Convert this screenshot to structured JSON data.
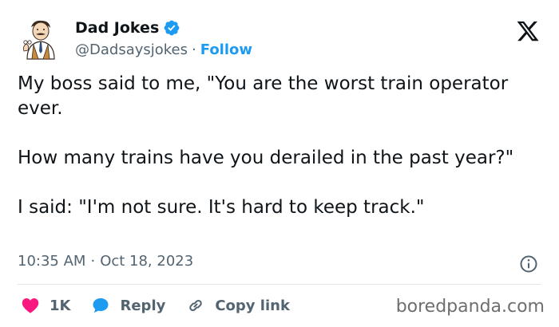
{
  "author": {
    "display_name": "Dad Jokes",
    "handle": "@Dadsaysjokes",
    "separator": "·",
    "follow_label": "Follow",
    "avatar_icon": "dad-cartoon-avatar",
    "verified_icon": "verified-badge-icon"
  },
  "platform_icon": "x-logo-icon",
  "tweet": {
    "paragraphs": [
      "My boss said to me, \"You are the worst train operator ever.",
      "How many trains have you derailed in the past year?\"",
      "I said: \"I'm not sure. It's hard to keep track.\""
    ]
  },
  "meta": {
    "time": "10:35 AM",
    "separator": "·",
    "date": "Oct 18, 2023"
  },
  "actions": {
    "like_count": "1K",
    "reply_label": "Reply",
    "copy_link_label": "Copy link"
  },
  "watermark": "boredpanda.com",
  "colors": {
    "accent": "#1d9bf0",
    "like": "#f91880",
    "text": "#0f1419",
    "muted": "#536471"
  }
}
